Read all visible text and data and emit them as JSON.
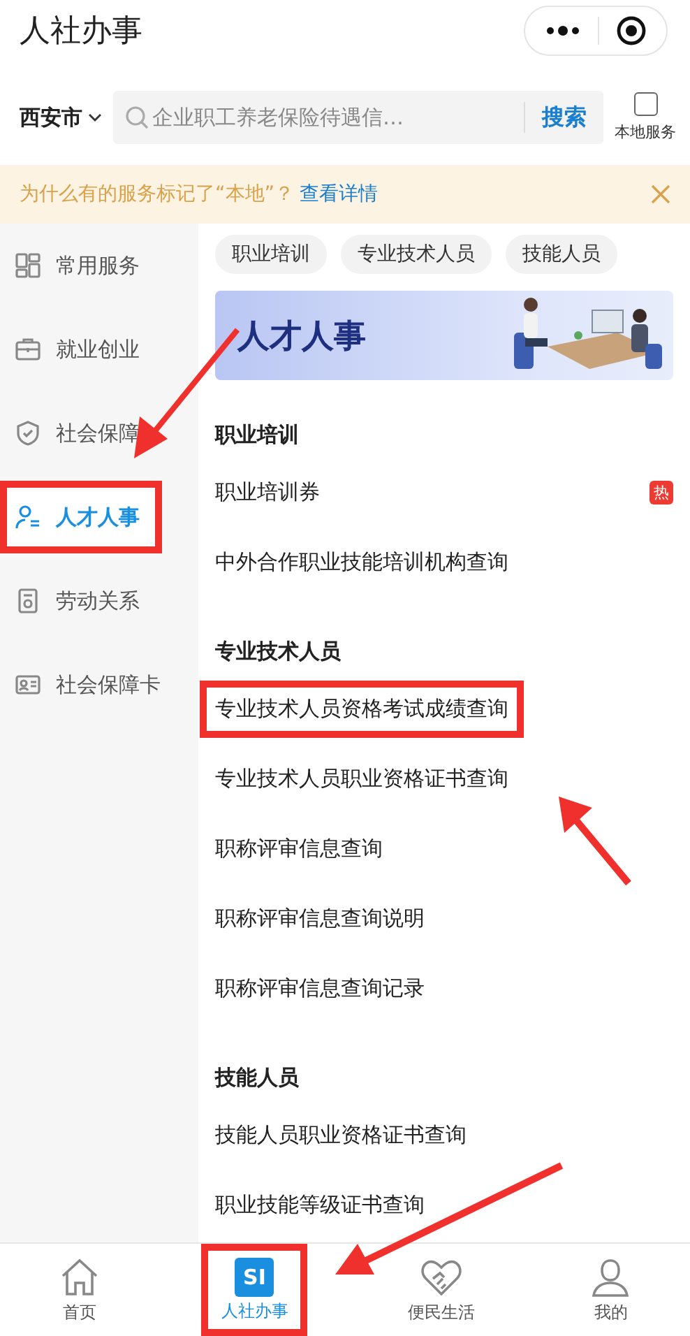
{
  "header": {
    "title": "人社办事"
  },
  "location": {
    "label": "西安市"
  },
  "search": {
    "placeholder": "企业职工养老保险待遇信…",
    "button": "搜索"
  },
  "local_filter": {
    "label": "本地服务",
    "checked": false
  },
  "notice": {
    "text": "为什么有的服务标记了“本地”？",
    "link": "查看详情"
  },
  "sidebar": {
    "items": [
      {
        "label": "常用服务",
        "selected": false,
        "highlighted": false
      },
      {
        "label": "就业创业",
        "selected": false,
        "highlighted": false
      },
      {
        "label": "社会保障",
        "selected": false,
        "highlighted": false
      },
      {
        "label": "人才人事",
        "selected": true,
        "highlighted": true
      },
      {
        "label": "劳动关系",
        "selected": false,
        "highlighted": false
      },
      {
        "label": "社会保障卡",
        "selected": false,
        "highlighted": false
      }
    ]
  },
  "chips": [
    "职业培训",
    "专业技术人员",
    "技能人员"
  ],
  "banner": {
    "title": "人才人事"
  },
  "sections": [
    {
      "title": "职业培训",
      "items": [
        {
          "label": "职业培训券",
          "badge": "热",
          "highlighted": false
        },
        {
          "label": "中外合作职业技能培训机构查询",
          "highlighted": false
        }
      ]
    },
    {
      "title": "专业技术人员",
      "items": [
        {
          "label": "专业技术人员资格考试成绩查询",
          "highlighted": true
        },
        {
          "label": "专业技术人员职业资格证书查询",
          "highlighted": false
        },
        {
          "label": "职称评审信息查询",
          "highlighted": false
        },
        {
          "label": "职称评审信息查询说明",
          "highlighted": false
        },
        {
          "label": "职称评审信息查询记录",
          "highlighted": false
        }
      ]
    },
    {
      "title": "技能人员",
      "items": [
        {
          "label": "技能人员职业资格证书查询",
          "highlighted": false
        },
        {
          "label": "职业技能等级证书查询",
          "highlighted": false
        }
      ]
    }
  ],
  "tab_bar": {
    "items": [
      {
        "label": "首页",
        "selected": false,
        "highlighted": false
      },
      {
        "label": "人社办事",
        "logo": "SI",
        "selected": true,
        "highlighted": true
      },
      {
        "label": "便民生活",
        "selected": false,
        "highlighted": false
      },
      {
        "label": "我的",
        "selected": false,
        "highlighted": false
      }
    ]
  }
}
